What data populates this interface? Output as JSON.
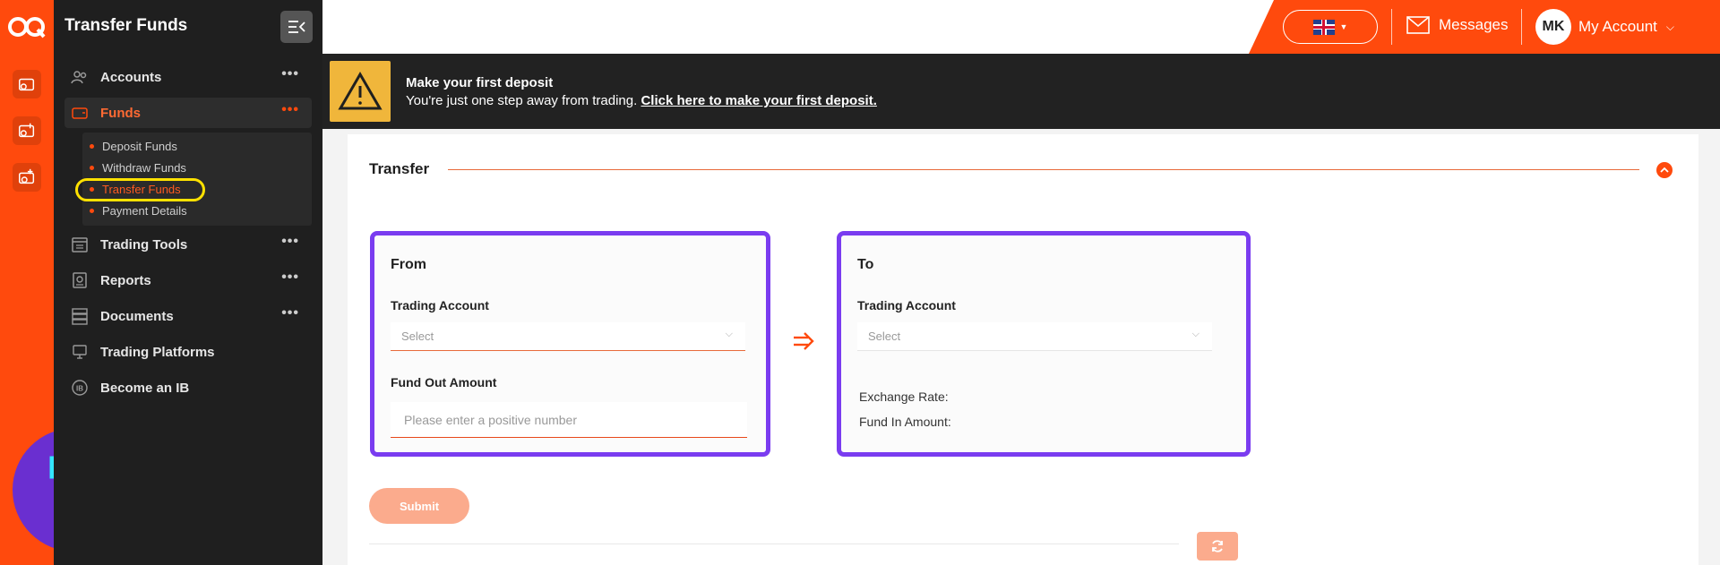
{
  "app": {
    "logo_text": "OQ",
    "page_title": "Transfer Funds"
  },
  "sidebar": {
    "items": [
      {
        "label": "Accounts",
        "icon": "accounts-icon",
        "has_more": true
      },
      {
        "label": "Funds",
        "icon": "wallet-icon",
        "has_more": true,
        "active": true
      },
      {
        "label": "Trading Tools",
        "icon": "calendar-icon",
        "has_more": true
      },
      {
        "label": "Reports",
        "icon": "reports-icon",
        "has_more": true
      },
      {
        "label": "Documents",
        "icon": "documents-icon",
        "has_more": true
      },
      {
        "label": "Trading Platforms",
        "icon": "platforms-icon",
        "has_more": false
      },
      {
        "label": "Become an IB",
        "icon": "ib-icon",
        "has_more": false
      }
    ],
    "funds_submenu": [
      {
        "label": "Deposit Funds"
      },
      {
        "label": "Withdraw Funds"
      },
      {
        "label": "Transfer Funds",
        "current": true
      },
      {
        "label": "Payment Details"
      }
    ],
    "more_symbol": "•••"
  },
  "header": {
    "language": "English (UK flag)",
    "messages_label": "Messages",
    "account_initials": "MK",
    "account_label": "My Account"
  },
  "banner": {
    "title": "Make your first deposit",
    "text": "You're just one step away from trading.",
    "link": "Click here to make your first deposit."
  },
  "transfer": {
    "section_title": "Transfer",
    "from": {
      "heading": "From",
      "account_label": "Trading Account",
      "account_placeholder": "Select",
      "amount_label": "Fund Out Amount",
      "amount_placeholder": "Please enter a positive number"
    },
    "to": {
      "heading": "To",
      "account_label": "Trading Account",
      "account_placeholder": "Select",
      "exchange_rate_label": "Exchange Rate:",
      "fund_in_label": "Fund In Amount:"
    },
    "submit_label": "Submit"
  },
  "colors": {
    "brand_orange": "#ff4a0d",
    "sidebar_dark": "#1f1f1f",
    "highlight_purple": "#7a3cf0",
    "highlight_yellow": "#ffe100"
  }
}
